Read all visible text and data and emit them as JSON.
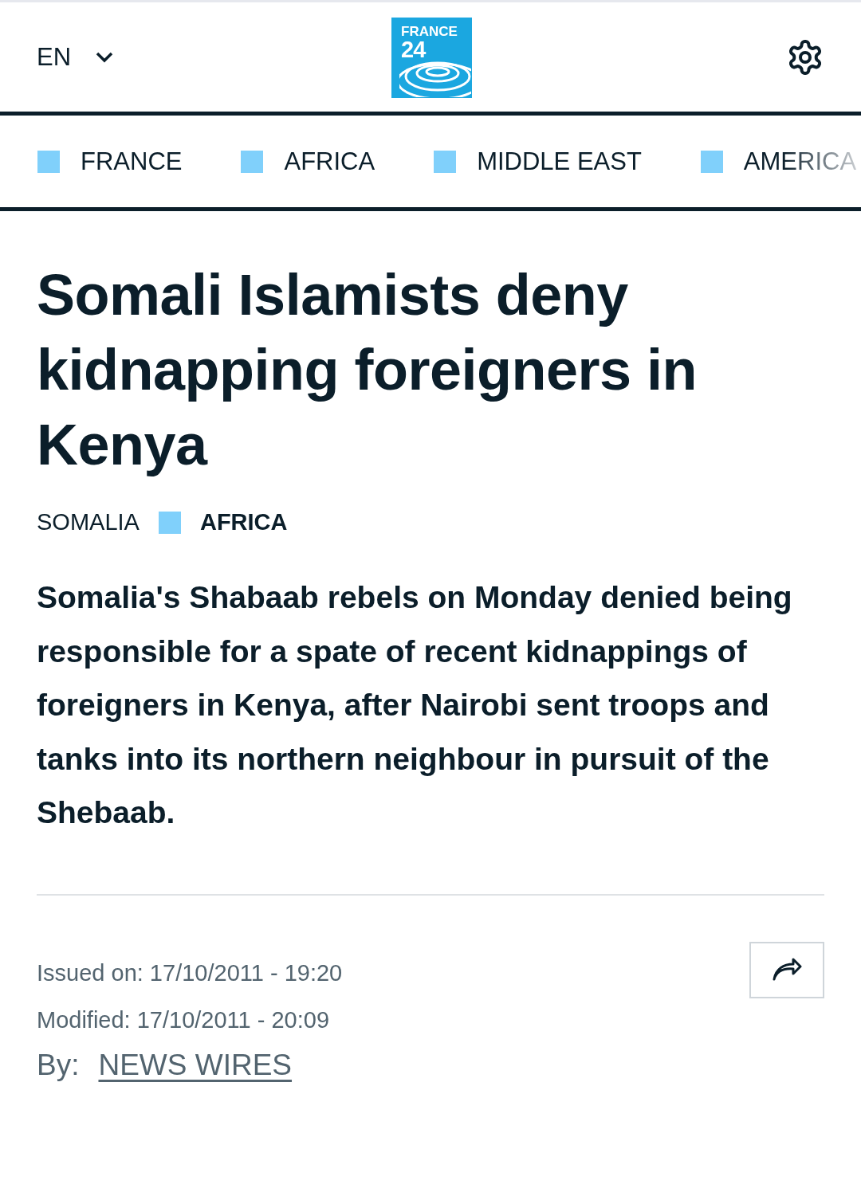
{
  "header": {
    "language": "EN",
    "logo": {
      "line_1": "FRANCE",
      "line_2": "24"
    }
  },
  "nav": [
    {
      "label": "FRANCE",
      "color": "#80d0fb"
    },
    {
      "label": "AFRICA",
      "color": "#80d0fb"
    },
    {
      "label": "MIDDLE EAST",
      "color": "#80d0fb"
    },
    {
      "label": "AMERICA",
      "color": "#80d0fb"
    }
  ],
  "article": {
    "title": "Somali Islamists deny kidnapping foreigners in Kenya",
    "tags": [
      {
        "label": "SOMALIA",
        "kind": "plain"
      },
      {
        "label": "AFRICA",
        "kind": "section",
        "color": "#80d0fb"
      }
    ],
    "lead": "Somalia's Shabaab rebels on Monday denied being responsible for a spate of recent kidnappings of foreigners in Kenya, after Nairobi sent troops and tanks into its northern neighbour in pursuit of the Shebaab.",
    "issued": "Issued on: 17/10/2011 - 19:20",
    "modified": "Modified: 17/10/2011 - 20:09",
    "by_label": "By:",
    "author": "NEWS WIRES"
  }
}
